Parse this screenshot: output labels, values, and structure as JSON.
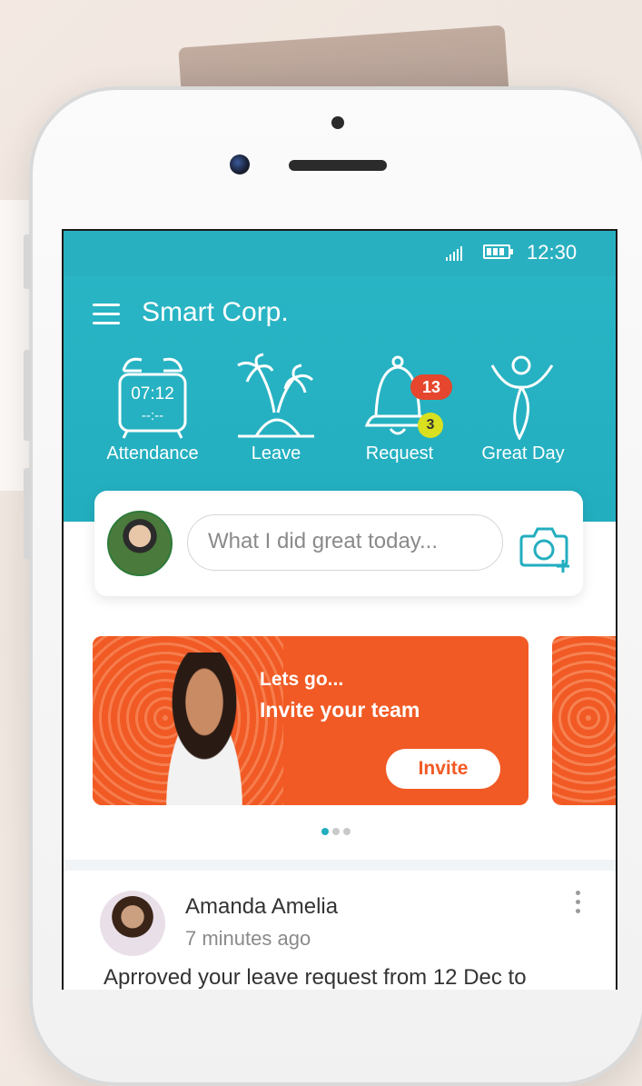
{
  "status_bar": {
    "time": "12:30",
    "signal_icon": "signal-icon",
    "battery_icon": "battery-icon"
  },
  "app": {
    "title": "Smart Corp.",
    "menu_icon": "hamburger-menu-icon"
  },
  "quick_actions": [
    {
      "label": "Attendance",
      "icon": "alarm-clock-icon",
      "clock_time": "07:12",
      "clock_sub": "--:--"
    },
    {
      "label": "Leave",
      "icon": "palm-tree-island-icon"
    },
    {
      "label": "Request",
      "icon": "bell-icon",
      "badge_primary": "13",
      "badge_secondary": "3"
    },
    {
      "label": "Great Day",
      "icon": "cheering-person-icon"
    }
  ],
  "status_post": {
    "placeholder": "What I did great today...",
    "camera_icon": "add-photo-icon"
  },
  "banner": {
    "line1": "Lets go...",
    "line2": "Invite your team",
    "button_label": "Invite",
    "color": "#f15a24"
  },
  "carousel": {
    "active_index": 0,
    "count": 3
  },
  "feed": {
    "author": "Amanda Amelia",
    "time": "7 minutes ago",
    "text": "Aprroved your leave request from 12 Dec to"
  },
  "colors": {
    "primary": "#22aebf",
    "accent": "#f15a24",
    "badge_red": "#e5462d",
    "badge_yellow": "#d9e01f"
  }
}
